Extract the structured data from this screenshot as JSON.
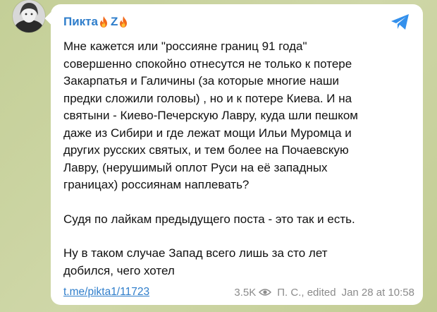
{
  "channel": {
    "name": "Пикта",
    "flag_letter": "Z",
    "icons": [
      "fire-icon",
      "fire-icon"
    ]
  },
  "message": {
    "lines_block1": [
      "Мне кажется или \"россияне границ 91 года\"",
      "совершенно спокойно отнесутся не только к потере",
      "Закарпатья и Галичины (за которые многие наши",
      "предки сложили головы) , но и к потере Киева. И на",
      "святыни - Киево-Печерскую Лавру, куда шли пешком",
      "даже из Сибири и где лежат мощи Ильи Муромца и",
      "других русских святых, и тем более на Почаевскую",
      "Лавру, (нерушимый оплот Руси на её западных",
      "границах) россиянам наплевать?"
    ],
    "line_block2": "Судя по лайкам предыдущего поста - это так и есть.",
    "lines_block3": [
      "Ну в таком случае Запад всего лишь за сто лет",
      "добился, чего хотел"
    ]
  },
  "footer": {
    "link": "t.me/pikta1/11723",
    "views": "3.5K",
    "author_edited": "П. С., edited",
    "timestamp": "Jan 28 at 10:58"
  },
  "colors": {
    "accent": "#2f7ecb",
    "meta": "#8b8b8b",
    "background": "#c9d3a0",
    "bubble": "#ffffff"
  },
  "share_icon": "share-arrow-icon"
}
